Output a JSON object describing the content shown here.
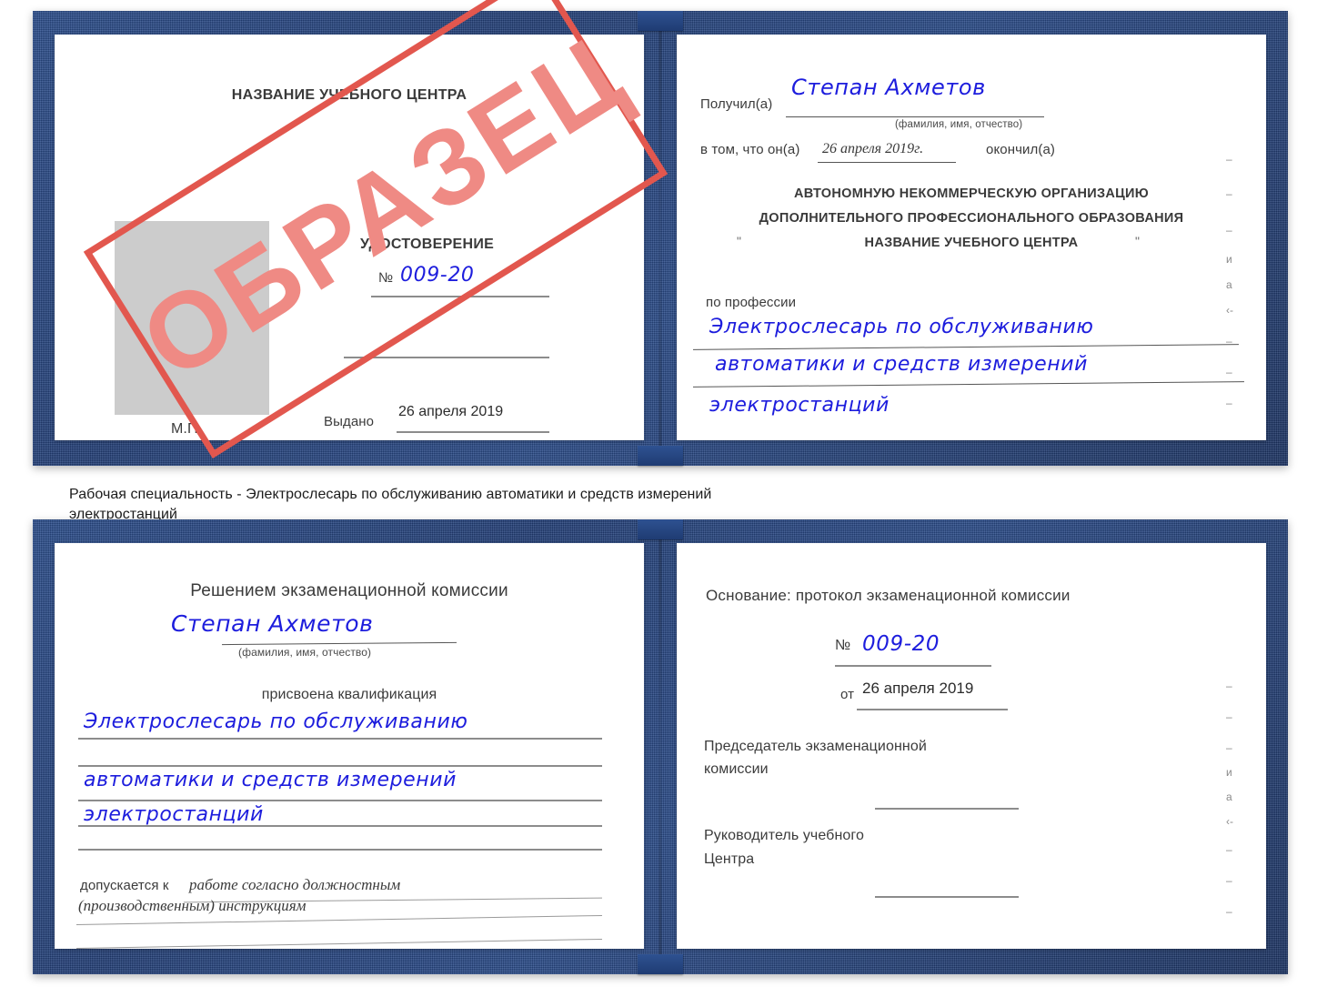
{
  "meta": {
    "stamp_text": "ОБРАЗЕЦ",
    "accent_red": "#e2574e",
    "stamp_fill": "#ef8a84",
    "cover_blue": "#2c4f8f",
    "ink_blue": "#1d1ddd",
    "rule_grey": "#8c8c8c"
  },
  "caption": {
    "line1": "Рабочая специальность - Электрослесарь по обслуживанию автоматики и средств измерений",
    "line2": "электростанций"
  },
  "cert_top": {
    "left_page": {
      "center_name": "НАЗВАНИЕ УЧЕБНОГО ЦЕНТРА",
      "doc_title": "УДОСТОВЕРЕНИЕ",
      "number_label": "№",
      "number_value": "009-20",
      "issued_label": "Выдано",
      "issued_value": "26 апреля 2019",
      "seal_label": "М.П.",
      "photo_placeholder": "photo-placeholder"
    },
    "right_page": {
      "received_label": "Получил(а)",
      "received_value": "Степан Ахметов",
      "fio_hint": "(фамилия, имя, отчество)",
      "that_he_label": "в том, что он(а)",
      "completion_date": "26 апреля 2019г.",
      "finished_label": "окончил(а)",
      "org_line1": "АВТОНОМНУЮ НЕКОММЕРЧЕСКУЮ ОРГАНИЗАЦИЮ",
      "org_line2": "ДОПОЛНИТЕЛЬНОГО ПРОФЕССИОНАЛЬНОГО ОБРАЗОВАНИЯ",
      "org_quote_open": "\"",
      "org_line3": "НАЗВАНИЕ УЧЕБНОГО ЦЕНТРА",
      "org_quote_close": "\"",
      "profession_label": "по профессии",
      "profession_line1": "Электрослесарь по обслуживанию",
      "profession_line2": "автоматики и средств измерений",
      "profession_line3": "электростанций",
      "edge_fragments": [
        "–",
        "–",
        "–",
        "и",
        "а",
        "‹-",
        "–",
        "–",
        "–"
      ]
    }
  },
  "cert_bottom": {
    "left_page": {
      "decision_title": "Решением экзаменационной комиссии",
      "name_value": "Степан Ахметов",
      "fio_hint": "(фамилия, имя, отчество)",
      "qualification_label": "присвоена квалификация",
      "qual_line1": "Электрослесарь по обслуживанию",
      "qual_line2": "автоматики и средств измерений",
      "qual_line3": "электростанций",
      "allowed_label": "допускается к",
      "allowed_line1": "работе согласно должностным",
      "allowed_line2": "(производственным) инструкциям"
    },
    "right_page": {
      "basis_label": "Основание: протокол экзаменационной комиссии",
      "number_label": "№",
      "number_value": "009-20",
      "from_label": "от",
      "from_value": "26 апреля 2019",
      "chairman_line1": "Председатель экзаменационной",
      "chairman_line2": "комиссии",
      "head_line1": "Руководитель учебного",
      "head_line2": "Центра",
      "edge_fragments": [
        "–",
        "–",
        "–",
        "и",
        "а",
        "‹-",
        "–",
        "–",
        "–"
      ]
    }
  }
}
